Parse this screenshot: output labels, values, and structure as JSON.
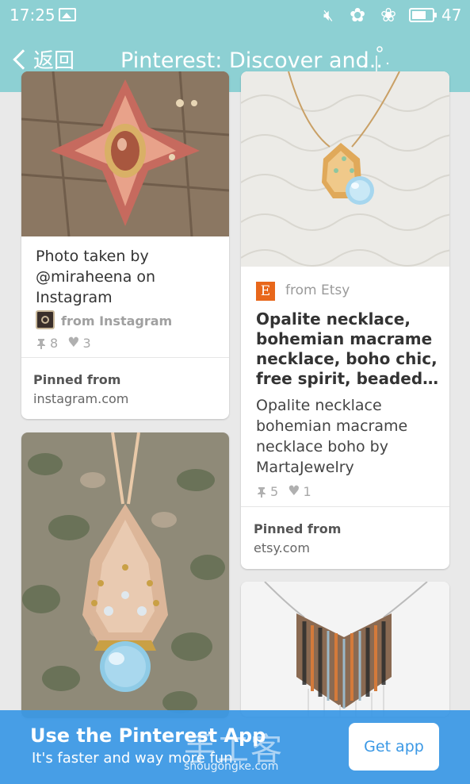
{
  "status_bar": {
    "time": "17:25",
    "battery": "47"
  },
  "header": {
    "back_label": "返回",
    "title": "Pinterest: Discover and.."
  },
  "pins": [
    {
      "description": [
        "Photo taken by",
        "@miraheena on",
        "Instagram"
      ],
      "source": "from Instagram",
      "repins": "8",
      "likes": "3",
      "pinned_from_label": "Pinned from",
      "pinned_from_site": "instagram.com"
    },
    {
      "source": "from Etsy",
      "source_badge": "E",
      "title": [
        "Opalite necklace,",
        "bohemian macrame",
        "necklace, boho chic,",
        "free spirit, beaded…"
      ],
      "description": [
        "Opalite necklace",
        "bohemian macrame",
        "necklace boho by",
        "MartaJewelry"
      ],
      "repins": "5",
      "likes": "1",
      "pinned_from_label": "Pinned from",
      "pinned_from_site": "etsy.com"
    }
  ],
  "banner": {
    "headline": "Use the Pinterest App",
    "subtext": "It's faster and way more fun.",
    "cta": "Get app"
  },
  "watermark": {
    "cn": "手工客",
    "url": "shougongke.com"
  },
  "colors": {
    "header_bg": "#8dd0d3",
    "banner_bg": "#3a98e5",
    "etsy_orange": "#e8671b"
  }
}
